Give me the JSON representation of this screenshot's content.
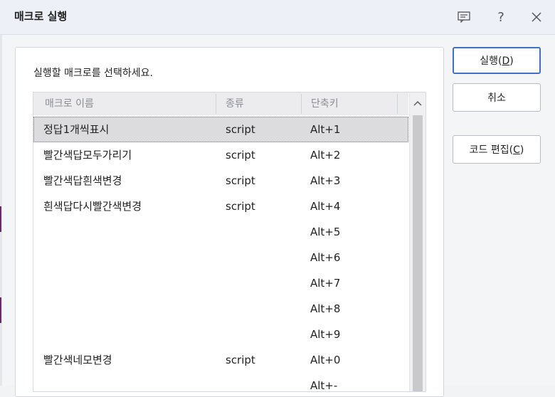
{
  "dialog": {
    "title": "매크로 실행",
    "prompt": "실행할 매크로를 선택하세요."
  },
  "titlebar_icons": [
    "comment-icon",
    "help-icon",
    "close-icon"
  ],
  "list": {
    "columns": [
      "매크로 이름",
      "종류",
      "단축키"
    ],
    "rows": [
      {
        "name": "정답1개씩표시",
        "type": "script",
        "shortcut": "Alt+1"
      },
      {
        "name": "빨간색답모두가리기",
        "type": "script",
        "shortcut": "Alt+2"
      },
      {
        "name": "빨간색답흰색변경",
        "type": "script",
        "shortcut": "Alt+3"
      },
      {
        "name": "흰색답다시빨간색변경",
        "type": "script",
        "shortcut": "Alt+4"
      },
      {
        "name": "",
        "type": "",
        "shortcut": "Alt+5"
      },
      {
        "name": "",
        "type": "",
        "shortcut": "Alt+6"
      },
      {
        "name": "",
        "type": "",
        "shortcut": "Alt+7"
      },
      {
        "name": "",
        "type": "",
        "shortcut": "Alt+8"
      },
      {
        "name": "",
        "type": "",
        "shortcut": "Alt+9"
      },
      {
        "name": "빨간색네모변경",
        "type": "script",
        "shortcut": "Alt+0"
      },
      {
        "name": "",
        "type": "",
        "shortcut": "Alt+-"
      }
    ],
    "selected_index": 0
  },
  "buttons": {
    "run": {
      "label": "실행(",
      "mnemonic": "D",
      "suffix": ")"
    },
    "cancel": {
      "label": "취소"
    },
    "edit_code": {
      "label": "코드 편집(",
      "mnemonic": "C",
      "suffix": ")"
    }
  },
  "colors": {
    "primary_border": "#3d72c9",
    "selected_row": "#dcdcde",
    "titlebar_bg": "#eef0f7"
  }
}
